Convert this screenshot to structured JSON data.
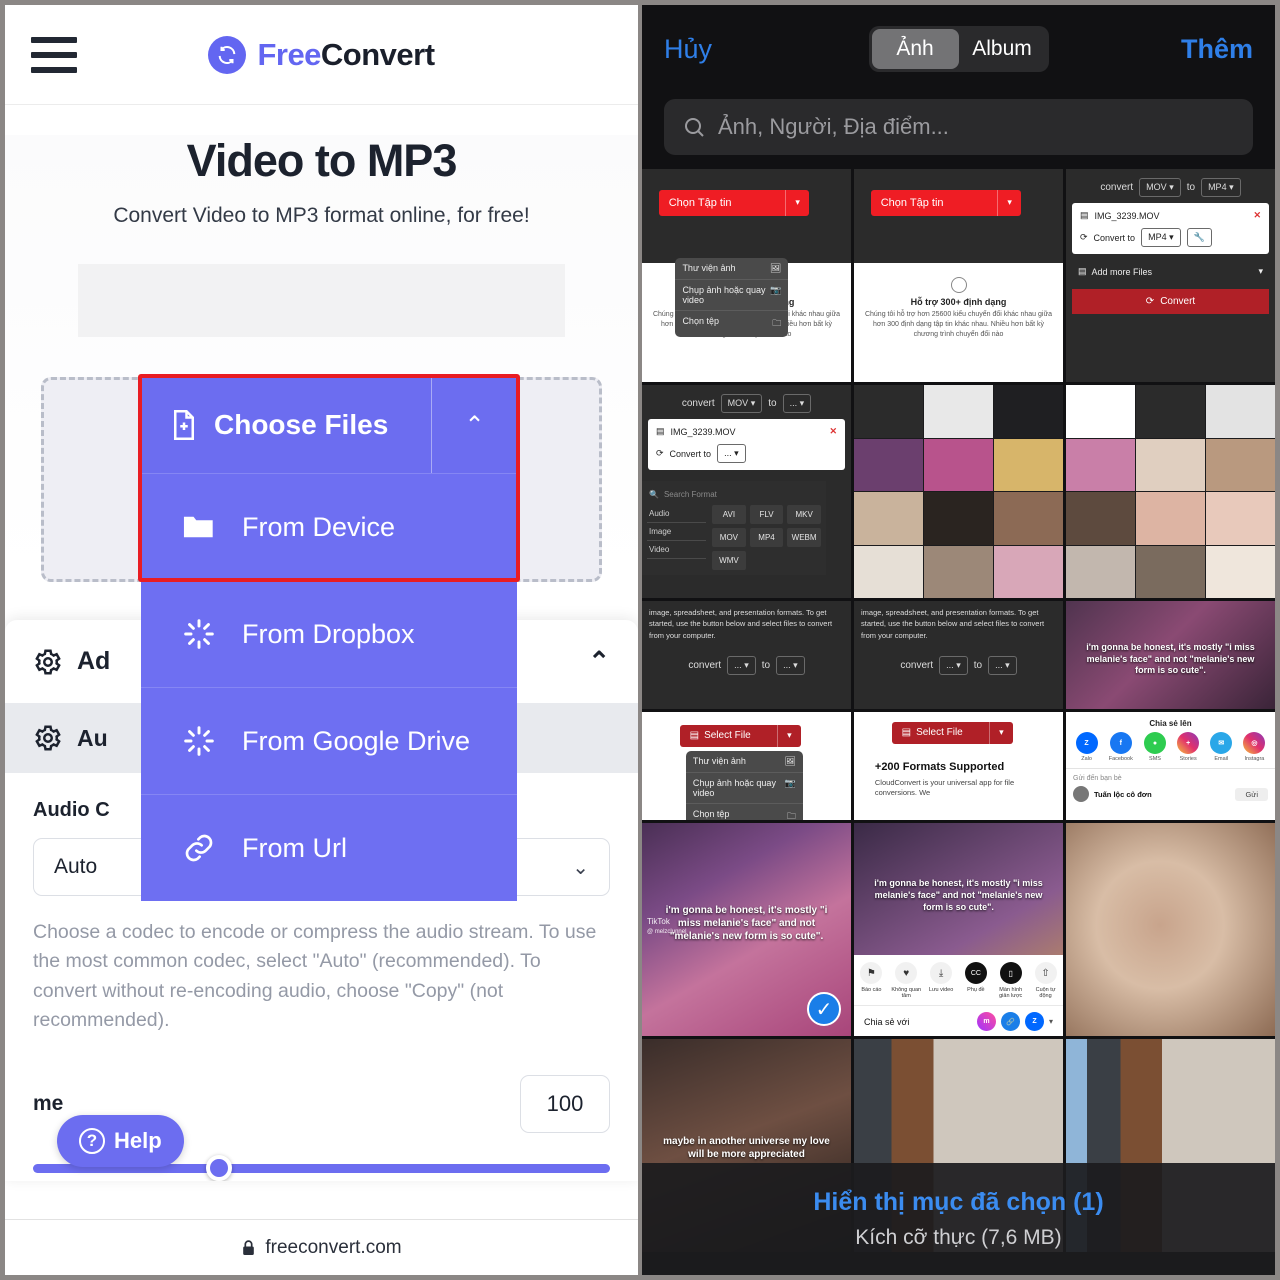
{
  "left_panel": {
    "brand": {
      "free": "Free",
      "convert": "Convert"
    },
    "title": "Video to MP3",
    "subtitle": "Convert Video to MP3 format online, for free!",
    "choose_files_label": "Choose Files",
    "dropdown_items": [
      {
        "label": "From Device",
        "icon": "folder-icon"
      },
      {
        "label": "From Dropbox",
        "icon": "spinner-icon"
      },
      {
        "label": "From Google Drive",
        "icon": "spinner-icon"
      },
      {
        "label": "From Url",
        "icon": "link-icon"
      }
    ],
    "advanced_options_label": "Ad",
    "audio_section_label": "Au",
    "audio_codec_label": "Audio C",
    "codec_value": "Auto",
    "codec_help": "Choose a codec to encode or compress the audio stream. To use the most common codec, select \"Auto\" (recommended). To convert without re-encoding audio, choose \"Copy\" (not recommended).",
    "volume_label": "me",
    "volume_value": "100",
    "help_label": "Help",
    "footer_domain": "freeconvert.com",
    "accent_color": "#6c6df0",
    "highlight_color": "#e81c23"
  },
  "right_panel": {
    "cancel_label": "Hủy",
    "add_label": "Thêm",
    "segments": [
      {
        "label": "Ảnh",
        "selected": true
      },
      {
        "label": "Album",
        "selected": false
      }
    ],
    "search_placeholder": "Ảnh, Người, Địa điểm...",
    "bottom_primary": "Hiển thị mục đã chọn (1)",
    "bottom_secondary": "Kích cỡ thực (7,6 MB)",
    "accent_color": "#2f7fe8",
    "highlight_color": "#e81c23",
    "shots": {
      "choose_file_vi": "Chọn Tập tin",
      "select_file_en": "Select File",
      "ctx_menu": [
        {
          "label": "Thư viện ảnh",
          "icon": "photos-icon"
        },
        {
          "label": "Chụp ảnh hoặc quay video",
          "icon": "camera-icon"
        },
        {
          "label": "Chọn tệp",
          "icon": "folder-icon"
        }
      ],
      "formats_heading_vi": "Hỗ trợ 300+ định dạng",
      "formats_body_vi": "Chúng tôi hỗ trợ hơn 25600 kiểu chuyển đổi khác nhau giữa hơn 300 định dạng tập tin khác nhau. Nhiều hơn bất kỳ chương trình chuyển đổi nào",
      "formats_heading_en": "+200 Formats Supported",
      "formats_body_en": "CloudConvert is your universal app for file conversions. We",
      "cc_body_en": "image, spreadsheet, and presentation formats. To get started, use the button below and select files to convert from your computer.",
      "convert_word": "convert",
      "to_word": "to",
      "ellipsis": "...",
      "mov": "MOV",
      "mp4": "MP4",
      "file_name": "IMG_3239.MOV",
      "convert_to_label": "Convert to",
      "add_more_files": "Add more Files",
      "convert_btn": "Convert",
      "search_format": "Search Format",
      "fmt_categories": [
        "Audio",
        "Image",
        "Video"
      ],
      "fmt_items": [
        "AVI",
        "FLV",
        "MKV",
        "MOV",
        "MP4",
        "WEBM",
        "WMV"
      ],
      "share_title_vi": "Chia sẻ lên",
      "share_apps": [
        {
          "label": "Zalo",
          "color": "#0068ff"
        },
        {
          "label": "Facebook",
          "color": "#1877f2"
        },
        {
          "label": "SMS",
          "color": "#2ecc50"
        },
        {
          "label": "Stories",
          "color": "#e1306c"
        },
        {
          "label": "Email",
          "color": "#2aa7e8"
        },
        {
          "label": "Instagra",
          "color": "#c13584"
        }
      ],
      "send_to_label": "Gửi đến bạn bè",
      "friend_name": "Tuấn lộc cô đơn",
      "send_btn": "Gửi",
      "tiktok_actions": [
        {
          "label": "Báo cáo",
          "icon": "flag-icon"
        },
        {
          "label": "Không quan tâm",
          "icon": "heart-broken-icon"
        },
        {
          "label": "Lưu video",
          "icon": "download-icon"
        },
        {
          "label": "Phụ đề",
          "icon": "cc-icon"
        },
        {
          "label": "Màn hình giản lược",
          "icon": "screen-icon"
        },
        {
          "label": "Cuộn tự động",
          "icon": "autoscroll-icon"
        }
      ],
      "share_with_label": "Chia sẻ với",
      "tiktok_watermark": "TikTok",
      "tiktok_handle": "@ melzclunnel",
      "caption_melanie": "i'm gonna be honest, it's mostly \"i miss melanie's face\" and not \"melanie's new form is so cute\".",
      "caption_universe": "maybe in another universe my love will be more appreciated"
    }
  }
}
